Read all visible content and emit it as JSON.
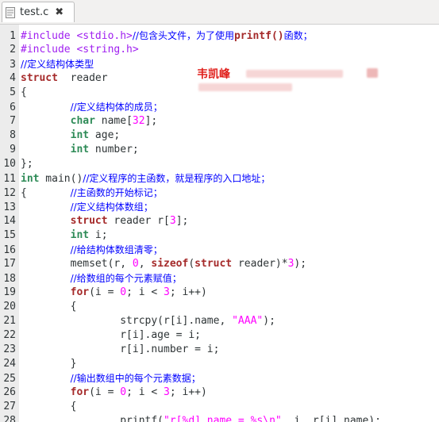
{
  "tab": {
    "filename": "test.c",
    "file_icon": "document-icon",
    "close_icon": "close-icon"
  },
  "author": "韦凯峰",
  "lines": [
    {
      "n": "1",
      "segs": [
        [
          "pp",
          "#include <stdio.h>"
        ],
        [
          "cm",
          "//包含头文件，为了使用"
        ],
        [
          "kw",
          "printf()"
        ],
        [
          "cm",
          "函数；"
        ]
      ]
    },
    {
      "n": "2",
      "segs": [
        [
          "pp",
          "#include <string.h>"
        ]
      ]
    },
    {
      "n": "3",
      "segs": [
        [
          "cm",
          "//定义结构体类型"
        ]
      ]
    },
    {
      "n": "4",
      "segs": [
        [
          "kw",
          "struct"
        ],
        [
          "",
          "  reader"
        ]
      ]
    },
    {
      "n": "5",
      "segs": [
        [
          "",
          "{"
        ]
      ]
    },
    {
      "n": "6",
      "segs": [
        [
          "",
          "        "
        ],
        [
          "cm",
          "//定义结构体的成员；"
        ]
      ]
    },
    {
      "n": "7",
      "segs": [
        [
          "",
          "        "
        ],
        [
          "ty",
          "char"
        ],
        [
          "",
          " name["
        ],
        [
          "nm",
          "32"
        ],
        [
          "",
          "];"
        ]
      ]
    },
    {
      "n": "8",
      "segs": [
        [
          "",
          "        "
        ],
        [
          "ty",
          "int"
        ],
        [
          "",
          " age;"
        ]
      ]
    },
    {
      "n": "9",
      "segs": [
        [
          "",
          "        "
        ],
        [
          "ty",
          "int"
        ],
        [
          "",
          " number;"
        ]
      ]
    },
    {
      "n": "10",
      "segs": [
        [
          "",
          "};"
        ]
      ]
    },
    {
      "n": "11",
      "segs": [
        [
          "ty",
          "int"
        ],
        [
          "",
          " main()"
        ],
        [
          "cm",
          "//定义程序的主函数，就是程序的入口地址；"
        ]
      ]
    },
    {
      "n": "12",
      "segs": [
        [
          "",
          "{       "
        ],
        [
          "cm",
          "//主函数的开始标记；"
        ]
      ]
    },
    {
      "n": "13",
      "segs": [
        [
          "",
          "        "
        ],
        [
          "cm",
          "//定义结构体数组；"
        ]
      ]
    },
    {
      "n": "14",
      "segs": [
        [
          "",
          "        "
        ],
        [
          "kw",
          "struct"
        ],
        [
          "",
          " reader r["
        ],
        [
          "nm",
          "3"
        ],
        [
          "",
          "];"
        ]
      ]
    },
    {
      "n": "15",
      "segs": [
        [
          "",
          "        "
        ],
        [
          "ty",
          "int"
        ],
        [
          "",
          " i;"
        ]
      ]
    },
    {
      "n": "16",
      "segs": [
        [
          "",
          "        "
        ],
        [
          "cm",
          "//给结构体数组清零；"
        ]
      ]
    },
    {
      "n": "17",
      "segs": [
        [
          "",
          "        memset(r, "
        ],
        [
          "nm",
          "0"
        ],
        [
          "",
          ", "
        ],
        [
          "kw",
          "sizeof"
        ],
        [
          "",
          "("
        ],
        [
          "kw",
          "struct"
        ],
        [
          "",
          " reader)*"
        ],
        [
          "nm",
          "3"
        ],
        [
          "",
          ");"
        ]
      ]
    },
    {
      "n": "18",
      "segs": [
        [
          "",
          "        "
        ],
        [
          "cm",
          "//给数组的每个元素赋值；"
        ]
      ]
    },
    {
      "n": "19",
      "segs": [
        [
          "",
          "        "
        ],
        [
          "kw",
          "for"
        ],
        [
          "",
          "(i = "
        ],
        [
          "nm",
          "0"
        ],
        [
          "",
          "; i < "
        ],
        [
          "nm",
          "3"
        ],
        [
          "",
          "; i++)"
        ]
      ]
    },
    {
      "n": "20",
      "segs": [
        [
          "",
          "        {"
        ]
      ]
    },
    {
      "n": "21",
      "segs": [
        [
          "",
          "                strcpy(r[i].name, "
        ],
        [
          "st",
          "\"AAA\""
        ],
        [
          "",
          ");"
        ]
      ]
    },
    {
      "n": "22",
      "segs": [
        [
          "",
          "                r[i].age = i;"
        ]
      ]
    },
    {
      "n": "23",
      "segs": [
        [
          "",
          "                r[i].number = i;"
        ]
      ]
    },
    {
      "n": "24",
      "segs": [
        [
          "",
          "        }"
        ]
      ]
    },
    {
      "n": "25",
      "segs": [
        [
          "",
          "        "
        ],
        [
          "cm",
          "//输出数组中的每个元素数据；"
        ]
      ]
    },
    {
      "n": "26",
      "segs": [
        [
          "",
          "        "
        ],
        [
          "kw",
          "for"
        ],
        [
          "",
          "(i = "
        ],
        [
          "nm",
          "0"
        ],
        [
          "",
          "; i < "
        ],
        [
          "nm",
          "3"
        ],
        [
          "",
          "; i++)"
        ]
      ]
    },
    {
      "n": "27",
      "segs": [
        [
          "",
          "        {"
        ]
      ]
    },
    {
      "n": "28",
      "segs": [
        [
          "",
          "                printf("
        ],
        [
          "st",
          "\"r[%d].name = %s\\n\""
        ],
        [
          "",
          ", i, r[i].name);"
        ]
      ]
    }
  ]
}
